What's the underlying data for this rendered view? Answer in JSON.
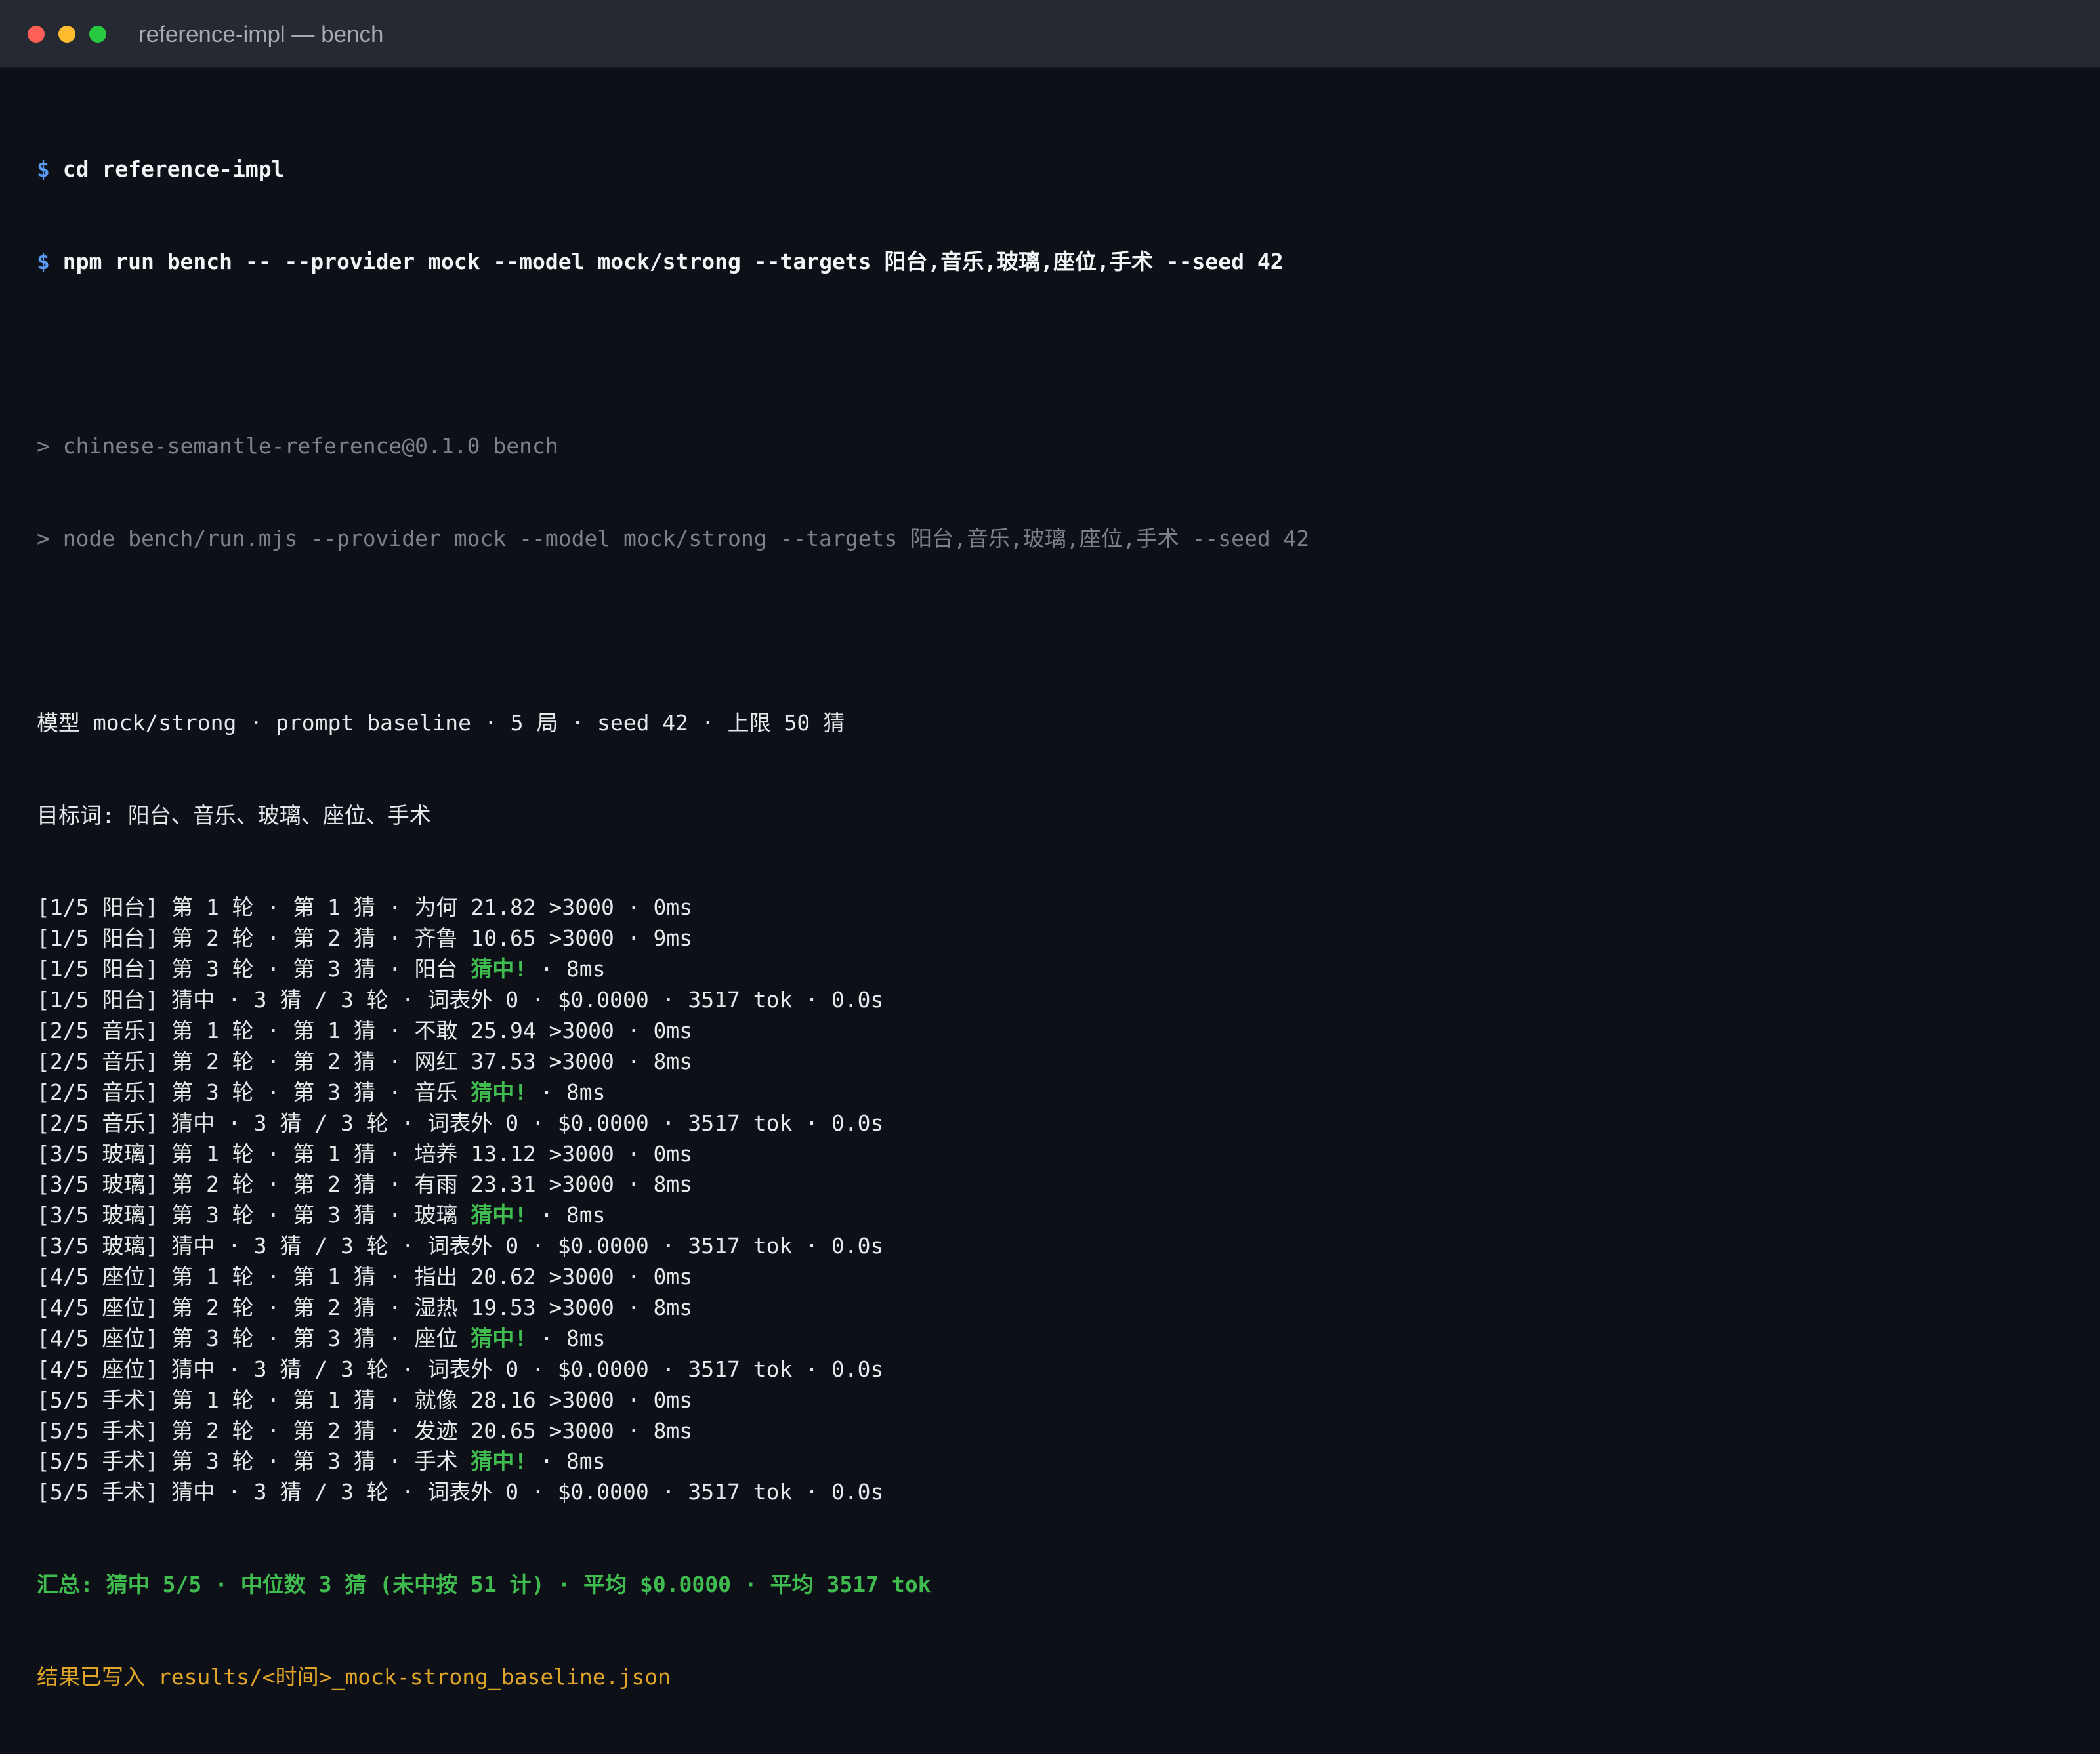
{
  "window": {
    "title": "reference-impl — bench"
  },
  "commands": [
    {
      "prompt": "$",
      "text": "cd reference-impl"
    },
    {
      "prompt": "$",
      "text": "npm run bench -- --provider mock --model mock/strong --targets 阳台,音乐,玻璃,座位,手术 --seed 42"
    }
  ],
  "npm_output": [
    "> chinese-semantle-reference@0.1.0 bench",
    "> node bench/run.mjs --provider mock --model mock/strong --targets 阳台,音乐,玻璃,座位,手术 --seed 42"
  ],
  "header_lines": [
    "模型 mock/strong · prompt baseline · 5 局 · seed 42 · 上限 50 猜",
    "目标词: 阳台、音乐、玻璃、座位、手术"
  ],
  "log": [
    {
      "text": "[1/5 阳台] 第 1 轮 · 第 1 猜 · 为何 21.82 >3000 · 0ms"
    },
    {
      "text": "[1/5 阳台] 第 2 轮 · 第 2 猜 · 齐鲁 10.65 >3000 · 9ms"
    },
    {
      "text": "[1/5 阳台] 第 3 轮 · 第 3 猜 · 阳台 ",
      "hit": "猜中!",
      "tail": " · 8ms"
    },
    {
      "text": "[1/5 阳台] 猜中 · 3 猜 / 3 轮 · 词表外 0 · $0.0000 · 3517 tok · 0.0s"
    },
    {
      "text": "[2/5 音乐] 第 1 轮 · 第 1 猜 · 不敢 25.94 >3000 · 0ms"
    },
    {
      "text": "[2/5 音乐] 第 2 轮 · 第 2 猜 · 网红 37.53 >3000 · 8ms"
    },
    {
      "text": "[2/5 音乐] 第 3 轮 · 第 3 猜 · 音乐 ",
      "hit": "猜中!",
      "tail": " · 8ms"
    },
    {
      "text": "[2/5 音乐] 猜中 · 3 猜 / 3 轮 · 词表外 0 · $0.0000 · 3517 tok · 0.0s"
    },
    {
      "text": "[3/5 玻璃] 第 1 轮 · 第 1 猜 · 培养 13.12 >3000 · 0ms"
    },
    {
      "text": "[3/5 玻璃] 第 2 轮 · 第 2 猜 · 有雨 23.31 >3000 · 8ms"
    },
    {
      "text": "[3/5 玻璃] 第 3 轮 · 第 3 猜 · 玻璃 ",
      "hit": "猜中!",
      "tail": " · 8ms"
    },
    {
      "text": "[3/5 玻璃] 猜中 · 3 猜 / 3 轮 · 词表外 0 · $0.0000 · 3517 tok · 0.0s"
    },
    {
      "text": "[4/5 座位] 第 1 轮 · 第 1 猜 · 指出 20.62 >3000 · 0ms"
    },
    {
      "text": "[4/5 座位] 第 2 轮 · 第 2 猜 · 湿热 19.53 >3000 · 8ms"
    },
    {
      "text": "[4/5 座位] 第 3 轮 · 第 3 猜 · 座位 ",
      "hit": "猜中!",
      "tail": " · 8ms"
    },
    {
      "text": "[4/5 座位] 猜中 · 3 猜 / 3 轮 · 词表外 0 · $0.0000 · 3517 tok · 0.0s"
    },
    {
      "text": "[5/5 手术] 第 1 轮 · 第 1 猜 · 就像 28.16 >3000 · 0ms"
    },
    {
      "text": "[5/5 手术] 第 2 轮 · 第 2 猜 · 发迹 20.65 >3000 · 8ms"
    },
    {
      "text": "[5/5 手术] 第 3 轮 · 第 3 猜 · 手术 ",
      "hit": "猜中!",
      "tail": " · 8ms"
    },
    {
      "text": "[5/5 手术] 猜中 · 3 猜 / 3 轮 · 词表外 0 · $0.0000 · 3517 tok · 0.0s"
    }
  ],
  "summary": "汇总: 猜中 5/5 · 中位数 3 猜 (未中按 51 计) · 平均 $0.0000 · 平均 3517 tok",
  "written": "结果已写入 results/<时间>_mock-strong_baseline.json",
  "colors": {
    "background": "#0d1017",
    "titlebar": "#252931",
    "prompt": "#5b9cf5",
    "hit": "#3fbb4f",
    "written": "#e0a528"
  }
}
